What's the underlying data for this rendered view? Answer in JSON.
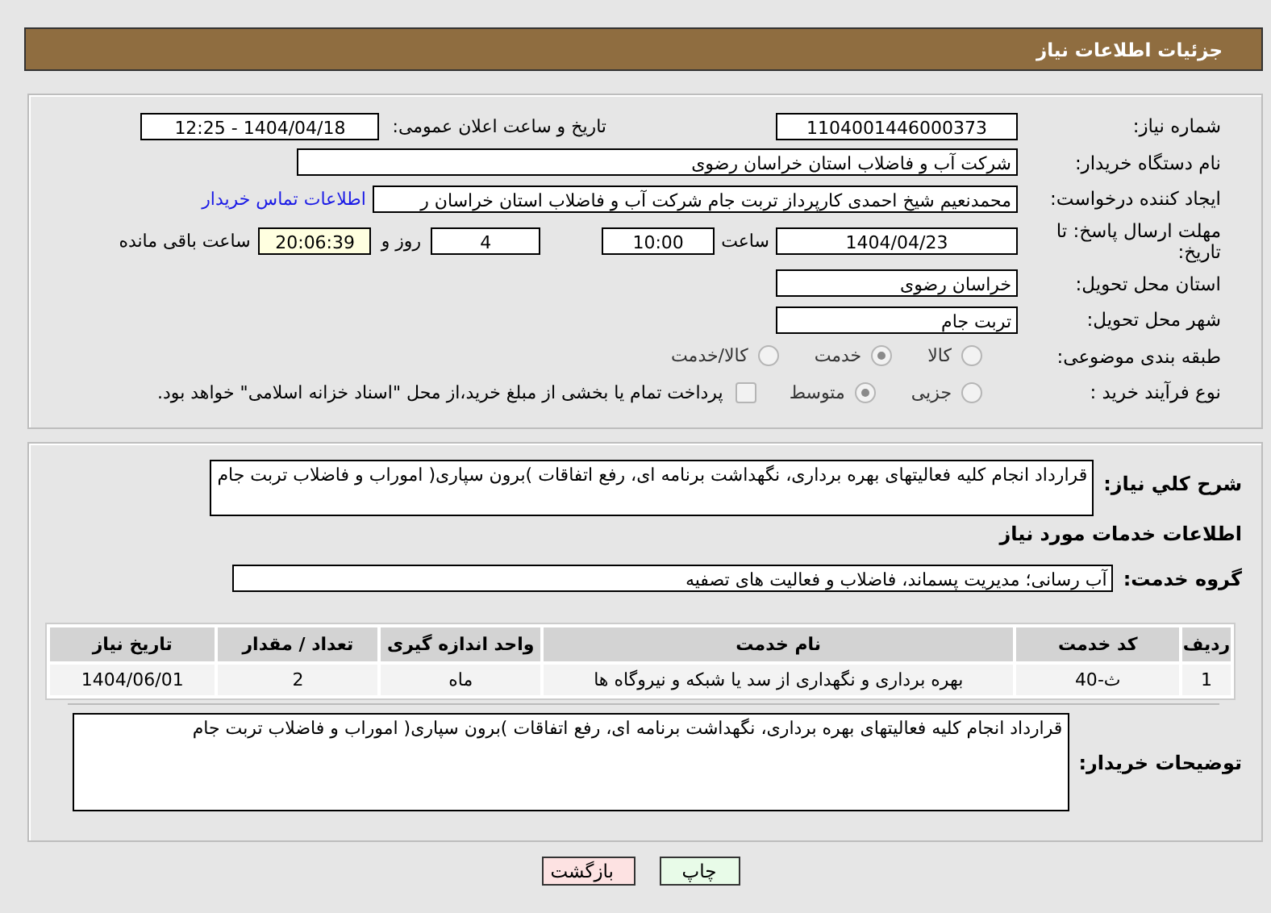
{
  "header": {
    "title": "جزئیات اطلاعات نیاز"
  },
  "need_number": {
    "label": "شماره نیاز:",
    "value": "1104001446000373"
  },
  "announce": {
    "label": "تاریخ و ساعت اعلان عمومی:",
    "value": "1404/04/18 - 12:25"
  },
  "buyer": {
    "label": "نام دستگاه خریدار:",
    "value": "شرکت آب و فاضلاب استان خراسان رضوی"
  },
  "creator": {
    "label": "ایجاد کننده درخواست:",
    "value": "محمدنعیم شیخ احمدی کارپرداز تربت جام  شرکت آب و فاضلاب استان خراسان ر",
    "link": "اطلاعات تماس خریدار"
  },
  "deadline": {
    "label": "مهلت ارسال پاسخ: تا تاریخ:",
    "date": "1404/04/23",
    "time_label": "ساعت",
    "time": "10:00",
    "days": "4",
    "days_label": "روز و",
    "remaining": "20:06:39",
    "remaining_label": "ساعت باقی مانده"
  },
  "province": {
    "label": "استان محل تحویل:",
    "value": "خراسان رضوی"
  },
  "city": {
    "label": "شهر محل تحویل:",
    "value": "تربت جام"
  },
  "category": {
    "label": "طبقه بندی موضوعی:",
    "options": [
      {
        "label": "کالا",
        "selected": false
      },
      {
        "label": "خدمت",
        "selected": true
      },
      {
        "label": "کالا/خدمت",
        "selected": false
      }
    ]
  },
  "purchase_type": {
    "label": "نوع فرآیند خرید :",
    "options": [
      {
        "label": "جزیی",
        "selected": false
      },
      {
        "label": "متوسط",
        "selected": true
      }
    ],
    "treasury": {
      "label": "پرداخت تمام یا بخشی از مبلغ خرید،از محل \"اسناد خزانه اسلامی\" خواهد بود.",
      "checked": false
    }
  },
  "description": {
    "label": "شرح کلي نیاز:",
    "value": "قرارداد انجام کلیه فعالیتهای بهره برداری، نگهداشت برنامه ای، رفع اتفاقات )برون سپاری( اموراب و فاضلاب تربت جام"
  },
  "services_heading": "اطلاعات خدمات مورد نیاز",
  "service_group": {
    "label": "گروه خدمت:",
    "value": "آب رسانی؛ مدیریت پسماند، فاضلاب و فعالیت های تصفیه"
  },
  "table": {
    "columns": [
      "ردیف",
      "کد خدمت",
      "نام خدمت",
      "واحد اندازه گیری",
      "تعداد / مقدار",
      "تاریخ نیاز"
    ],
    "rows": [
      [
        "1",
        "ث-40",
        "بهره برداری و نگهداری از سد یا شبکه و نیروگاه ها",
        "ماه",
        "2",
        "1404/06/01"
      ]
    ]
  },
  "buyer_notes": {
    "label": "توضیحات خریدار:",
    "value": "قرارداد انجام کلیه فعالیتهای بهره برداری، نگهداشت برنامه ای، رفع اتفاقات )برون سپاری( اموراب و فاضلاب تربت جام"
  },
  "buttons": [
    {
      "label": "چاپ",
      "kind": "print"
    },
    {
      "label": "بازگشت",
      "kind": "back"
    }
  ]
}
